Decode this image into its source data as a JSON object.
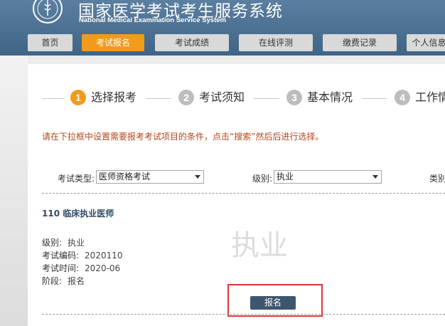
{
  "header": {
    "title": "国家医学考试考生服务系统",
    "subtitle": "National Medical Examination Service System"
  },
  "nav": [
    {
      "label": "首页",
      "active": false
    },
    {
      "label": "考试报名",
      "active": true
    },
    {
      "label": "考试成绩",
      "active": false
    },
    {
      "label": "在线评测",
      "active": false
    },
    {
      "label": "缴费记录",
      "active": false
    },
    {
      "label": "个人信息",
      "active": false
    }
  ],
  "steps": [
    {
      "number": "1",
      "label": "选择报考",
      "active": true
    },
    {
      "number": "2",
      "label": "考试须知",
      "active": false
    },
    {
      "number": "3",
      "label": "基本情况",
      "active": false
    },
    {
      "number": "4",
      "label": "工作情",
      "active": false
    }
  ],
  "hint": "请在下拉框中设置需要报考考试项目的条件，点击“搜索”然后后进行选择。",
  "filters": {
    "exam_type_label": "考试类型:",
    "exam_type_value": "医师资格考试",
    "level_label": "级别:",
    "level_value": "执业",
    "category_label": "类别"
  },
  "exam": {
    "title": "110 临床执业医师",
    "level_key": "级别:",
    "level_value": "执业",
    "code_key": "考试编码:",
    "code_value": "2020110",
    "time_key": "考试时间:",
    "time_value": "2020-06",
    "stage_key": "阶段:",
    "stage_value": "报名",
    "watermark": "执业",
    "apply_label": "报名"
  },
  "colors": {
    "header": "#4a6d8f",
    "accent": "#f39a1c",
    "highlight": "#e2333a",
    "button": "#3d566e"
  }
}
